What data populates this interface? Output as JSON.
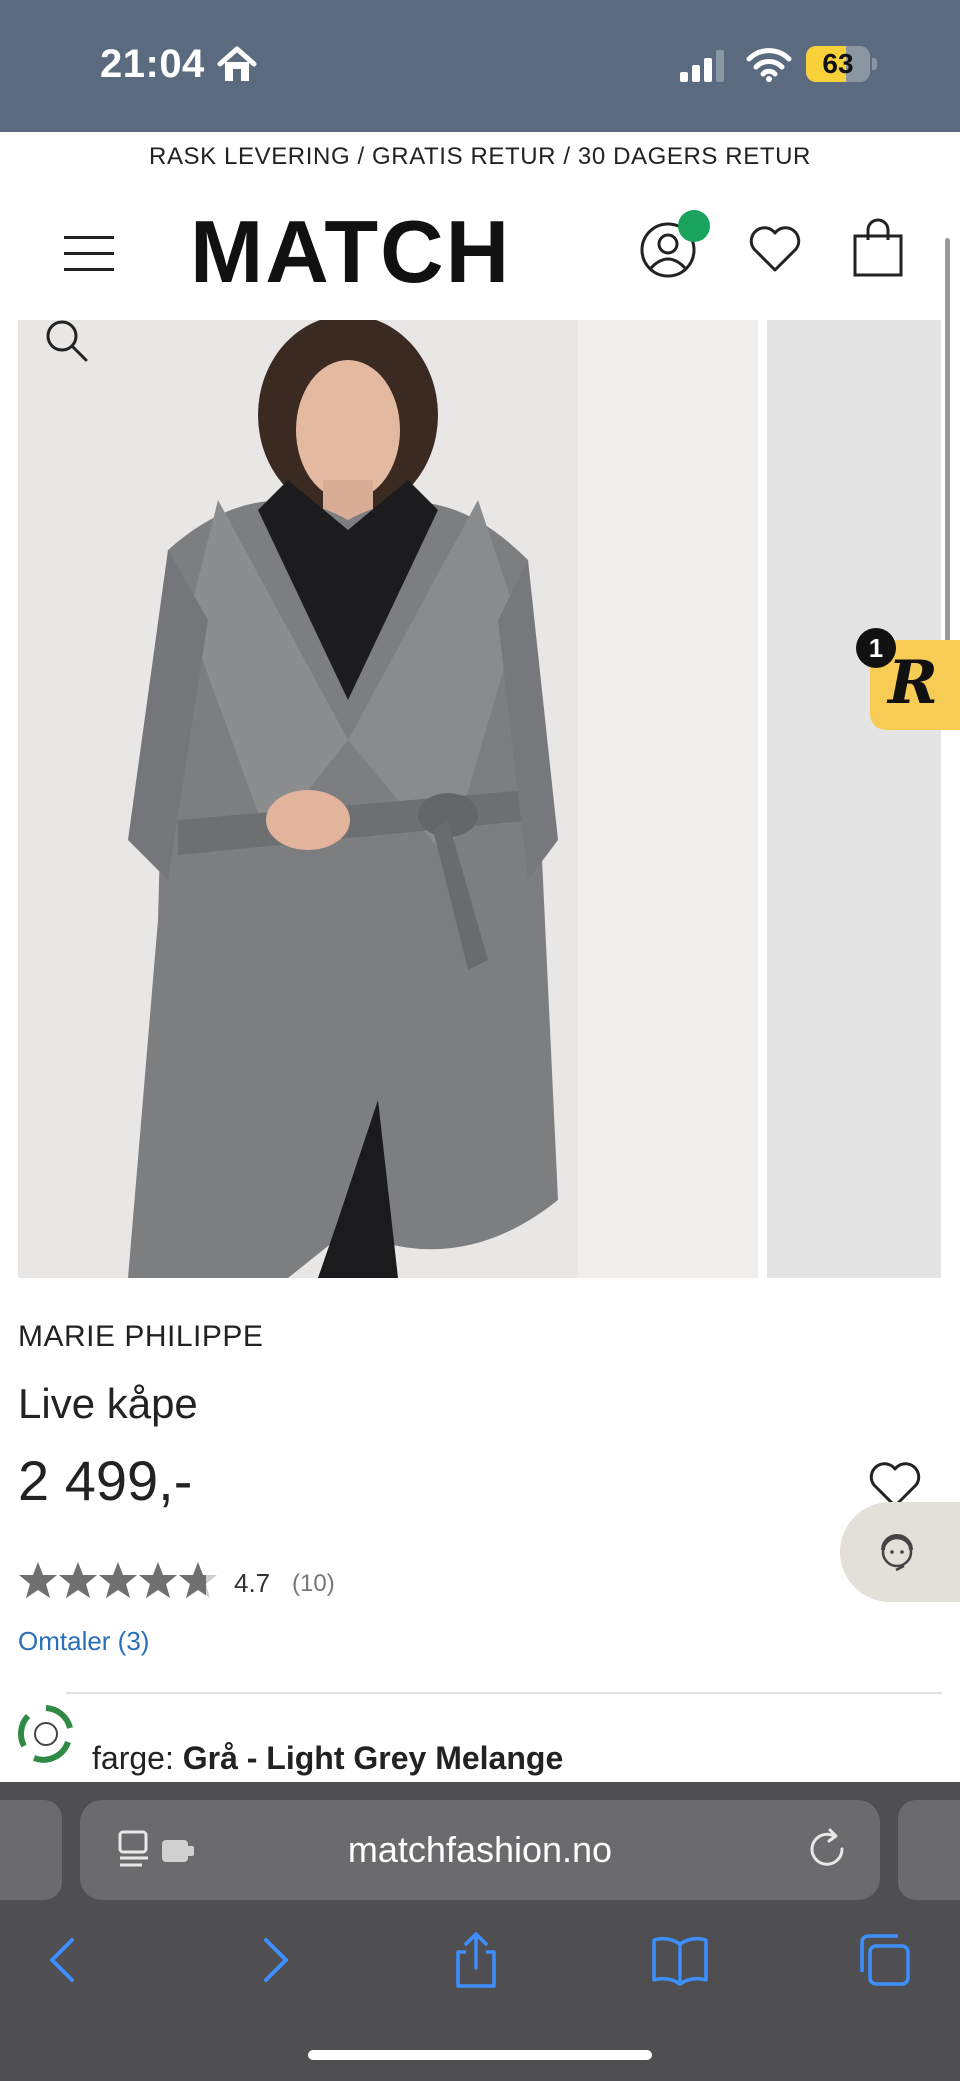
{
  "status_bar": {
    "time": "21:04",
    "battery_percent": "63",
    "battery_level": 0.63
  },
  "promo": {
    "text": "RASK LEVERING / GRATIS RETUR / 30 DAGERS RETUR"
  },
  "header": {
    "logo": "MATCH"
  },
  "widget": {
    "badge_letter": "R",
    "badge_count": "1"
  },
  "product": {
    "brand": "MARIE PHILIPPE",
    "name": "Live kåpe",
    "price": "2 499,-",
    "rating": "4.7",
    "rating_value": 4.7,
    "rating_count": "(10)",
    "reviews_link": "Omtaler (3)",
    "color_label": "farge:",
    "color_value": "Grå - Light Grey Melange"
  },
  "browser": {
    "url": "matchfashion.no"
  },
  "colors": {
    "status_bar": "#5b6b7f",
    "accent_green": "#1aa35c",
    "badge_yellow": "#f6cc54",
    "link_blue": "#2a6fb8",
    "browser_chrome": "#4f4f51"
  }
}
